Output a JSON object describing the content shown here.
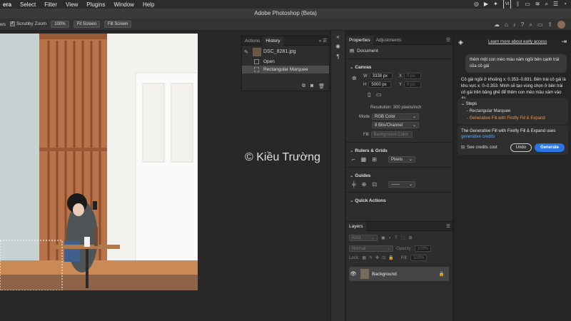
{
  "menubar": {
    "items": [
      "era",
      "Select",
      "Filter",
      "View",
      "Plugins",
      "Window",
      "Help"
    ],
    "vi_badge": "VI"
  },
  "titlebar": {
    "title": "Adobe Photoshop (Beta)"
  },
  "options": {
    "tool_suffix": "ws",
    "scrubby_zoom": "Scrubby Zoom",
    "zoom_value": "100%",
    "fit_screen": "Fit Screen",
    "fill_screen": "Fill Screen"
  },
  "history": {
    "tabs": [
      "Actions",
      "History"
    ],
    "snapshot": "DSC_8281.jpg",
    "states": [
      "Open",
      "Rectangular Marquee"
    ]
  },
  "properties": {
    "tabs": [
      "Properties",
      "Adjustments"
    ],
    "doc_label": "Document",
    "canvas": {
      "title": "Canvas",
      "w_label": "W",
      "w_value": "3338 px",
      "h_label": "H",
      "h_value": "5000 px",
      "x_label": "X",
      "x_value": "0 px",
      "y_label": "Y",
      "y_value": "0 px",
      "resolution": "Resolution: 300 pixels/inch",
      "mode_label": "Mode",
      "mode_value": "RGB Color",
      "depth_value": "8 Bits/Channel",
      "fill_label": "Fill",
      "fill_value": "Background Color"
    },
    "rulers": {
      "title": "Rulers & Grids",
      "units": "Pixels"
    },
    "guides": {
      "title": "Guides"
    },
    "quick": {
      "title": "Quick Actions"
    }
  },
  "layers": {
    "tab": "Layers",
    "kind": "Kind",
    "blend": "Normal",
    "opacity_label": "Opacity:",
    "opacity": "100%",
    "lock_label": "Lock:",
    "fill_label": "Fill:",
    "fill": "100%",
    "layer_name": "Background"
  },
  "ai": {
    "learn_more": "Learn more about early access",
    "user_msg": "thêm một con mèo màu xám ngồi bên cạnh trái của cô gái",
    "reply": "Cô gái ngồi ở khoảng x: 0.353–0.831. Bên trái cô gái là khu vực x: 0–0.353. Mình sẽ tạo vùng chọn ở bên trái cô gái trên băng ghế để thêm con mèo màu xám vào đó.",
    "steps_title": "Steps",
    "step1": "- Rectangular Marquee",
    "step2": "- Generative Fill with Firefly Fill & Expand",
    "gen_text": "The Generative Fill with Firefly Fill & Expand uses",
    "gen_link": "generative credits",
    "see_credits": "See credits cost",
    "undo": "Undo",
    "generate": "Generate"
  },
  "watermark": "© Kiều Trường",
  "colors": {
    "accent_blue": "#2b73e6",
    "step_orange": "#f0954a",
    "link_blue": "#58a8ff"
  }
}
